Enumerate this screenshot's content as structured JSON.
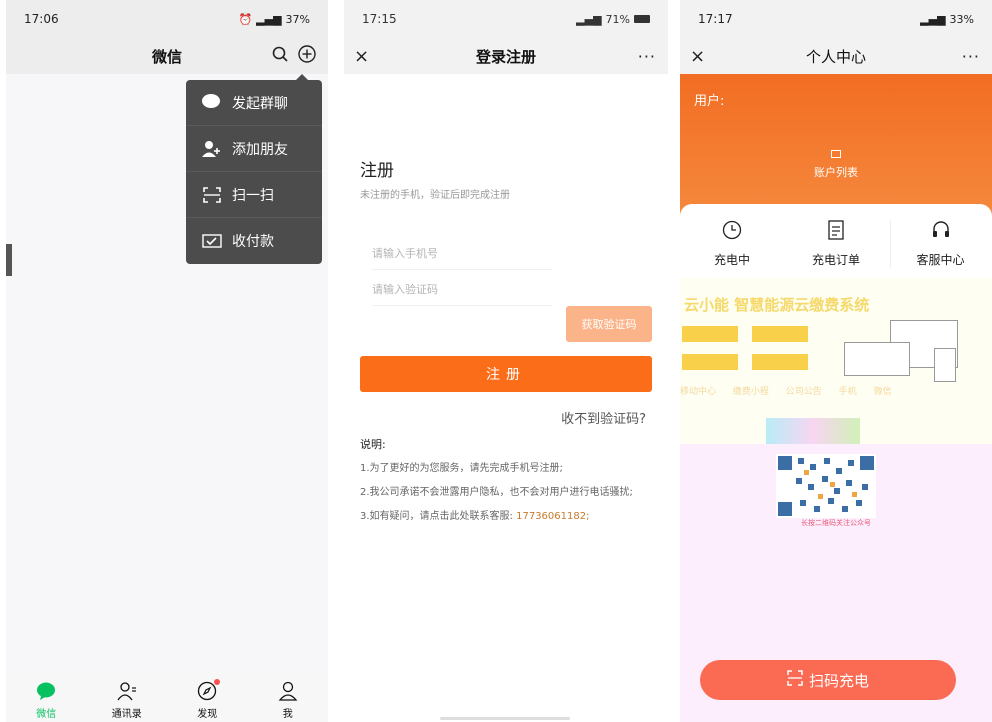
{
  "screen1": {
    "status": {
      "time": "17:06",
      "battery": "37%",
      "icons": [
        "alarm-icon",
        "vibrate-icon",
        "bluetooth-icon",
        "signal-icon",
        "signal-icon"
      ]
    },
    "header": {
      "title": "微信"
    },
    "menu": [
      {
        "label": "发起群聊",
        "icon": "chat-bubble-icon"
      },
      {
        "label": "添加朋友",
        "icon": "add-user-icon"
      },
      {
        "label": "扫一扫",
        "icon": "scan-icon"
      },
      {
        "label": "收付款",
        "icon": "payment-icon"
      }
    ],
    "tabs": [
      {
        "label": "微信",
        "icon": "chat-icon",
        "active": true
      },
      {
        "label": "通讯录",
        "icon": "contacts-icon",
        "active": false
      },
      {
        "label": "发现",
        "icon": "compass-icon",
        "active": false,
        "badge": true
      },
      {
        "label": "我",
        "icon": "person-icon",
        "active": false
      }
    ]
  },
  "screen2": {
    "status": {
      "time": "17:15",
      "battery": "71%"
    },
    "header": {
      "title": "登录注册",
      "close": "×",
      "more": "···"
    },
    "form": {
      "title": "注册",
      "subtitle": "未注册的手机，验证后即完成注册",
      "phone_placeholder": "请输入手机号",
      "code_placeholder": "请输入验证码",
      "get_code": "获取验证码",
      "submit": "注册",
      "no_code": "收不到验证码?"
    },
    "notes": {
      "title": "说明:",
      "items": [
        "1.为了更好的为您服务，请先完成手机号注册;",
        "2.我公司承诺不会泄露用户隐私，也不会对用户进行电话骚扰;",
        "3.如有疑问，请点击此处联系客服:"
      ],
      "phone": "17736061182",
      "phone_suffix": ";"
    }
  },
  "screen3": {
    "status": {
      "time": "17:17",
      "battery": "33%"
    },
    "header": {
      "title": "个人中心",
      "close": "×",
      "more": "···"
    },
    "user_label": "用户:",
    "account_list": "账户列表",
    "actions": [
      {
        "label": "充电中",
        "icon": "clock-icon"
      },
      {
        "label": "充电订单",
        "icon": "document-icon"
      },
      {
        "label": "客服中心",
        "icon": "headset-icon"
      }
    ],
    "promo": {
      "title": "云小能  智慧能源云缴费系统",
      "row": "移动中心 缴费小程 公司公告 手机 微信"
    },
    "qr_caption": "长按二维码关注公众号",
    "scan_button": "扫码充电",
    "colors": {
      "accent": "#f26d23",
      "button": "#fb6b53",
      "wechat_green": "#07c160"
    }
  }
}
